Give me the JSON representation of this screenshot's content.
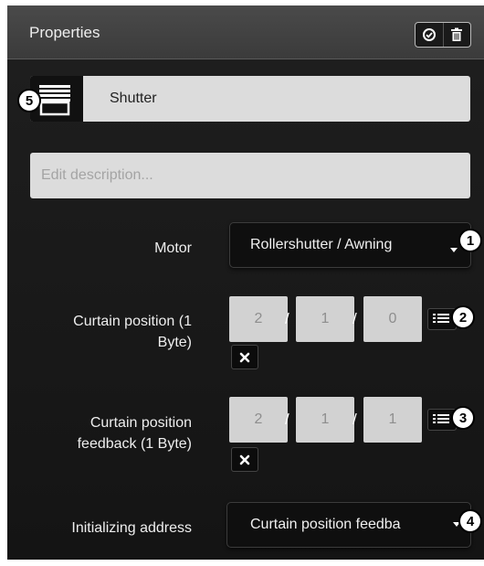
{
  "header": {
    "title": "Properties"
  },
  "name": {
    "value": "Shutter"
  },
  "description": {
    "placeholder": "Edit description..."
  },
  "motor": {
    "label": "Motor",
    "value": "Rollershutter / Awning"
  },
  "curtain_position": {
    "label_line1": "Curtain position (1",
    "label_line2": "Byte)",
    "main": "2",
    "middle": "1",
    "sub": "0"
  },
  "curtain_feedback": {
    "label_line1": "Curtain position",
    "label_line2": "feedback (1 Byte)",
    "main": "2",
    "middle": "1",
    "sub": "1"
  },
  "initializing": {
    "label": "Initializing address",
    "value": "Curtain position feedba"
  },
  "address_separator": "/",
  "badges": [
    "1",
    "2",
    "3",
    "4",
    "5"
  ],
  "icons": {
    "header_check": "check-circle-icon",
    "header_delete": "trash-icon",
    "name_icon": "shutter-icon",
    "list": "list-icon",
    "clear": "close-x-icon"
  }
}
